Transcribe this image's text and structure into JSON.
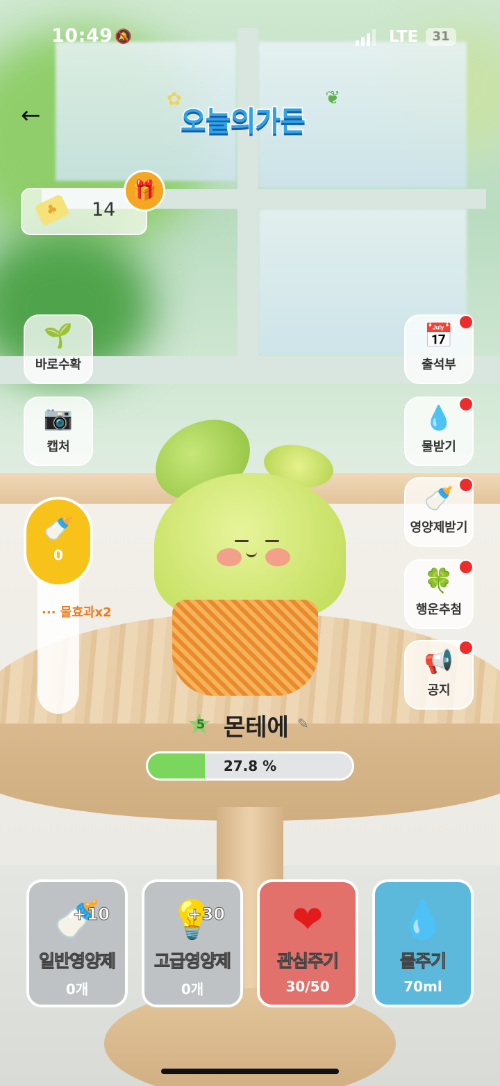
{
  "status_bar": {
    "time": "10:49",
    "network": "LTE",
    "battery": "31"
  },
  "header": {
    "logo_text": "오늘의가든"
  },
  "ticket": {
    "count": "14"
  },
  "left_buttons": [
    {
      "label": "바로수확",
      "icon": "sprout-harvest-icon"
    },
    {
      "label": "캡처",
      "icon": "camera-icon"
    }
  ],
  "right_buttons": [
    {
      "label": "출석부",
      "icon": "calendar-icon",
      "badge": true
    },
    {
      "label": "물받기",
      "icon": "water-drop-icon",
      "badge": true
    },
    {
      "label": "영양제받기",
      "icon": "nutrient-bottle-icon",
      "badge": true
    },
    {
      "label": "행운추첨",
      "icon": "clover-icon",
      "badge": true
    },
    {
      "label": "공지",
      "icon": "megaphone-icon",
      "badge": true
    }
  ],
  "gauge": {
    "value": "0",
    "bonus_label": "물효과x2"
  },
  "plant": {
    "level": "5",
    "name": "몬테에",
    "progress_text": "27.8 %",
    "progress_value": 27.8
  },
  "actions": [
    {
      "title": "일반영양제",
      "sub": "0개",
      "plus": "+10",
      "bg": "#bfc2c4"
    },
    {
      "title": "고급영양제",
      "sub": "0개",
      "plus": "+30",
      "bg": "#bfc2c4"
    },
    {
      "title": "관심주기",
      "sub": "30/50",
      "plus": "",
      "bg": "#e2716c"
    },
    {
      "title": "물주기",
      "sub": "70ml",
      "plus": "",
      "bg": "#5cb9dc"
    }
  ]
}
